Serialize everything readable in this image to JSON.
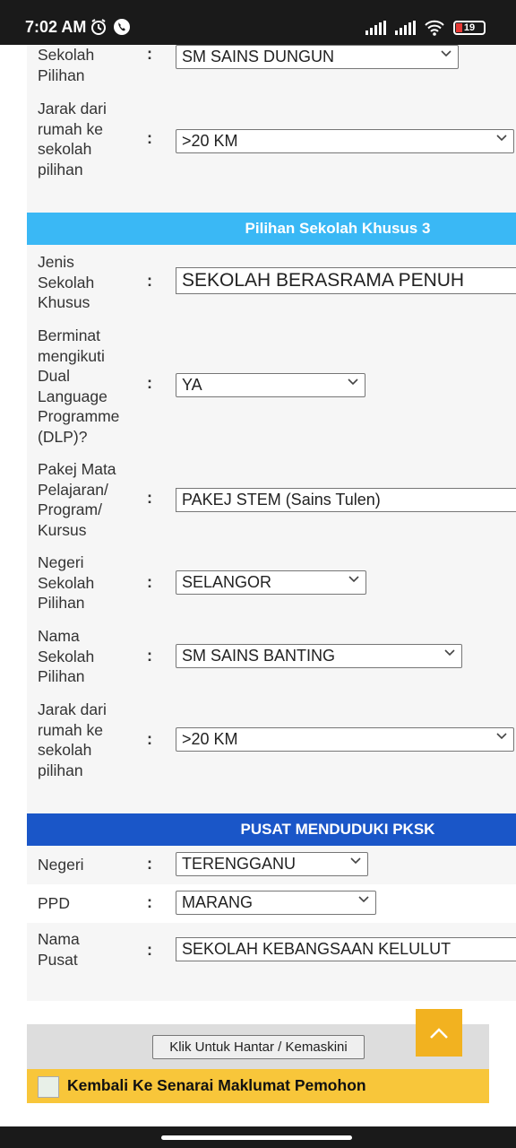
{
  "status_bar": {
    "time": "7:02 AM",
    "battery": "19"
  },
  "form": {
    "top": {
      "sekolah_pilihan_label": "Sekolah\nPilihan",
      "sekolah_pilihan_value": "SM SAINS DUNGUN",
      "jarak_label": "Jarak dari\nrumah ke\nsekolah\npilihan",
      "jarak_value": ">20 KM"
    },
    "khusus3": {
      "header": "Pilihan Sekolah Khusus 3",
      "jenis_label": "Jenis\nSekolah\nKhusus",
      "jenis_value": "SEKOLAH BERASRAMA PENUH",
      "dlp_label": "Berminat\nmengikuti\nDual\nLanguage\nProgramme\n(DLP)?",
      "dlp_value": "YA",
      "pakej_label": "Pakej Mata\nPelajaran/\nProgram/\nKursus",
      "pakej_value": "PAKEJ STEM (Sains Tulen)",
      "negeri_label": "Negeri\nSekolah\nPilihan",
      "negeri_value": "SELANGOR",
      "nama_label": "Nama\nSekolah\nPilihan",
      "nama_value": "SM SAINS BANTING",
      "jarak_label": "Jarak dari\nrumah ke\nsekolah\npilihan",
      "jarak_value": ">20 KM"
    },
    "pusat": {
      "header": "PUSAT MENDUDUKI PKSK",
      "negeri_label": "Negeri",
      "negeri_value": "TERENGGANU",
      "ppd_label": "PPD",
      "ppd_value": "MARANG",
      "nama_label": "Nama\nPusat",
      "nama_value": "SEKOLAH KEBANGSAAN KELULUT"
    },
    "colon": ":",
    "submit_label": "Klik Untuk Hantar / Kemaskini",
    "back_label": "Kembali Ke Senarai Maklumat Pemohon"
  },
  "colors": {
    "header_khusus": "#3ab8f5",
    "header_pusat": "#1a56c8",
    "back_bar": "#f8c63a",
    "scroll_top": "#f2b220"
  }
}
